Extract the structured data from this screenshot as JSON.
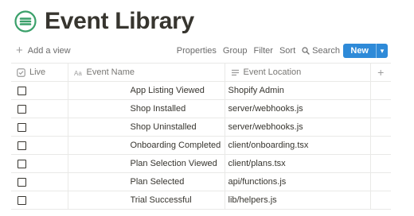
{
  "page": {
    "title": "Event Library",
    "accent_color": "#2e8ad8",
    "logo_color": "#3aa06a"
  },
  "toolbar": {
    "add_view": "Add a view",
    "properties": "Properties",
    "group": "Group",
    "filter": "Filter",
    "sort": "Sort",
    "search": "Search",
    "more": "···",
    "new": "New"
  },
  "table": {
    "columns": [
      {
        "label": "Live",
        "icon": "checkbox-icon"
      },
      {
        "label": "Event Name",
        "icon": "text-property-icon"
      },
      {
        "label": "Event Location",
        "icon": "lines-icon"
      }
    ],
    "rows": [
      {
        "live": false,
        "name": "App Listing Viewed",
        "location": "Shopify Admin"
      },
      {
        "live": false,
        "name": "Shop Installed",
        "location": "server/webhooks.js"
      },
      {
        "live": false,
        "name": "Shop Uninstalled",
        "location": "server/webhooks.js"
      },
      {
        "live": false,
        "name": "Onboarding Completed",
        "location": "client/onboarding.tsx"
      },
      {
        "live": false,
        "name": "Plan Selection Viewed",
        "location": "client/plans.tsx"
      },
      {
        "live": false,
        "name": "Plan Selected",
        "location": "api/functions.js"
      },
      {
        "live": false,
        "name": "Trial Successful",
        "location": "lib/helpers.js"
      }
    ]
  }
}
